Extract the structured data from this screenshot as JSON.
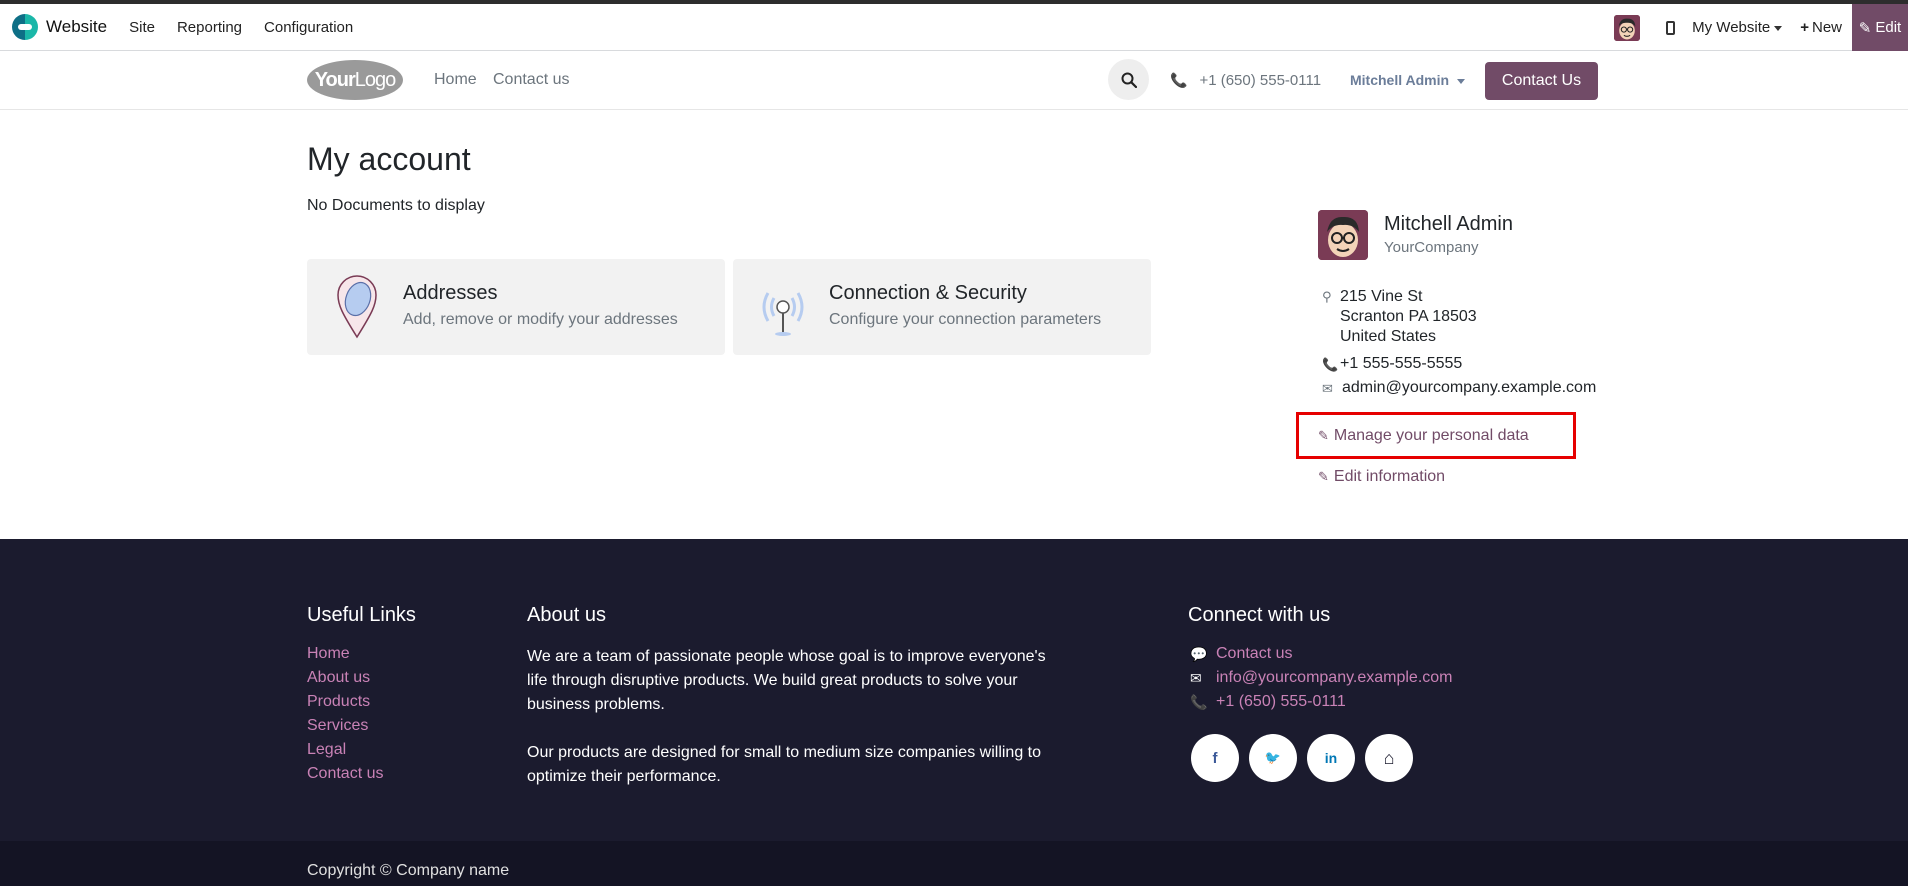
{
  "adminbar": {
    "app_name": "Website",
    "menus": [
      "Site",
      "Reporting",
      "Configuration"
    ],
    "website_selector": "My Website",
    "new_label": "New",
    "new_icon": "+",
    "edit_label": "Edit",
    "edit_icon": "✎"
  },
  "header": {
    "logo_text_bold": "Your",
    "logo_text": "Logo",
    "nav": [
      "Home",
      "Contact us"
    ],
    "phone": "+1 (650) 555-0111",
    "user": "Mitchell Admin",
    "contact_button": "Contact Us"
  },
  "main": {
    "title": "My account",
    "no_docs": "No Documents to display",
    "cards": [
      {
        "title": "Addresses",
        "subtitle": "Add, remove or modify your addresses",
        "icon": "map-pin-icon"
      },
      {
        "title": "Connection & Security",
        "subtitle": "Configure your connection parameters",
        "icon": "antenna-icon"
      }
    ]
  },
  "profile": {
    "name": "Mitchell Admin",
    "company": "YourCompany",
    "address_line1": "215 Vine St",
    "address_line2": "Scranton PA 18503",
    "address_line3": "United States",
    "phone": "+1 555-555-5555",
    "email": "admin@yourcompany.example.com",
    "manage_link": "Manage your personal data",
    "edit_link": "Edit information"
  },
  "footer": {
    "useful_links_heading": "Useful Links",
    "useful_links": [
      "Home",
      "About us",
      "Products",
      "Services",
      "Legal",
      "Contact us"
    ],
    "about_heading": "About us",
    "about_p1": "We are a team of passionate people whose goal is to improve everyone's life through disruptive products. We build great products to solve your business problems.",
    "about_p2": "Our products are designed for small to medium size companies willing to optimize their performance.",
    "connect_heading": "Connect with us",
    "contact_us": "Contact us",
    "email": "info@yourcompany.example.com",
    "phone": "+1 (650) 555-0111",
    "social": [
      {
        "name": "facebook-icon",
        "glyph": "f",
        "color": "#3b5998"
      },
      {
        "name": "twitter-icon",
        "glyph": "🐦",
        "color": "#1da1f2"
      },
      {
        "name": "linkedin-icon",
        "glyph": "in",
        "color": "#0077b5"
      },
      {
        "name": "home-icon",
        "glyph": "⌂",
        "color": "#1b1b2e"
      }
    ],
    "copyright": "Copyright © Company name"
  },
  "colors": {
    "brand": "#714b67",
    "footer_bg": "#1b1b2e",
    "footer_link": "#c982b6",
    "highlight_box": "#e60000"
  }
}
